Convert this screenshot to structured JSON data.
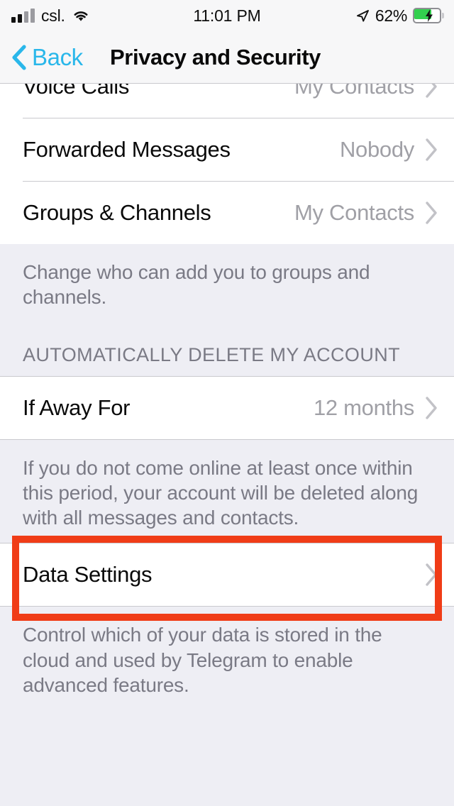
{
  "status_bar": {
    "carrier": "csl.",
    "wifi_icon": "wifi-icon",
    "signal_icon": "signal-bars-icon",
    "time": "11:01 PM",
    "location_icon": "location-arrow-icon",
    "battery_percent": "62%",
    "battery_icon": "battery-charging-icon",
    "battery_level": 62
  },
  "nav": {
    "back_label": "Back",
    "back_icon": "chevron-left-icon",
    "title": "Privacy and Security"
  },
  "rows": {
    "voice_calls": {
      "title": "Voice Calls",
      "value": "My Contacts",
      "chevron": "chevron-right-icon"
    },
    "forwarded_messages": {
      "title": "Forwarded Messages",
      "value": "Nobody",
      "chevron": "chevron-right-icon"
    },
    "groups_channels": {
      "title": "Groups & Channels",
      "value": "My Contacts",
      "chevron": "chevron-right-icon"
    },
    "if_away_for": {
      "title": "If Away For",
      "value": "12 months",
      "chevron": "chevron-right-icon"
    },
    "data_settings": {
      "title": "Data Settings",
      "value": "",
      "chevron": "chevron-right-icon"
    }
  },
  "footers": {
    "groups": "Change who can add you to groups and channels.",
    "auto_delete": "If you do not come online at least once within this period, your account will be deleted along with all messages and contacts.",
    "data_settings": "Control which of your data is stored in the cloud and used by Telegram to enable advanced features."
  },
  "sections": {
    "auto_delete_header": "AUTOMATICALLY DELETE MY ACCOUNT"
  },
  "annotation": {
    "highlight_color": "#f03c17",
    "target": "data-settings-row"
  },
  "colors": {
    "accent_blue": "#2ab7ea",
    "background": "#eeeef4",
    "row_background": "#ffffff",
    "separator": "#c9c9ce",
    "secondary_text": "#a0a0a6",
    "footer_text": "#7a7a85",
    "battery_green": "#32d04e"
  }
}
